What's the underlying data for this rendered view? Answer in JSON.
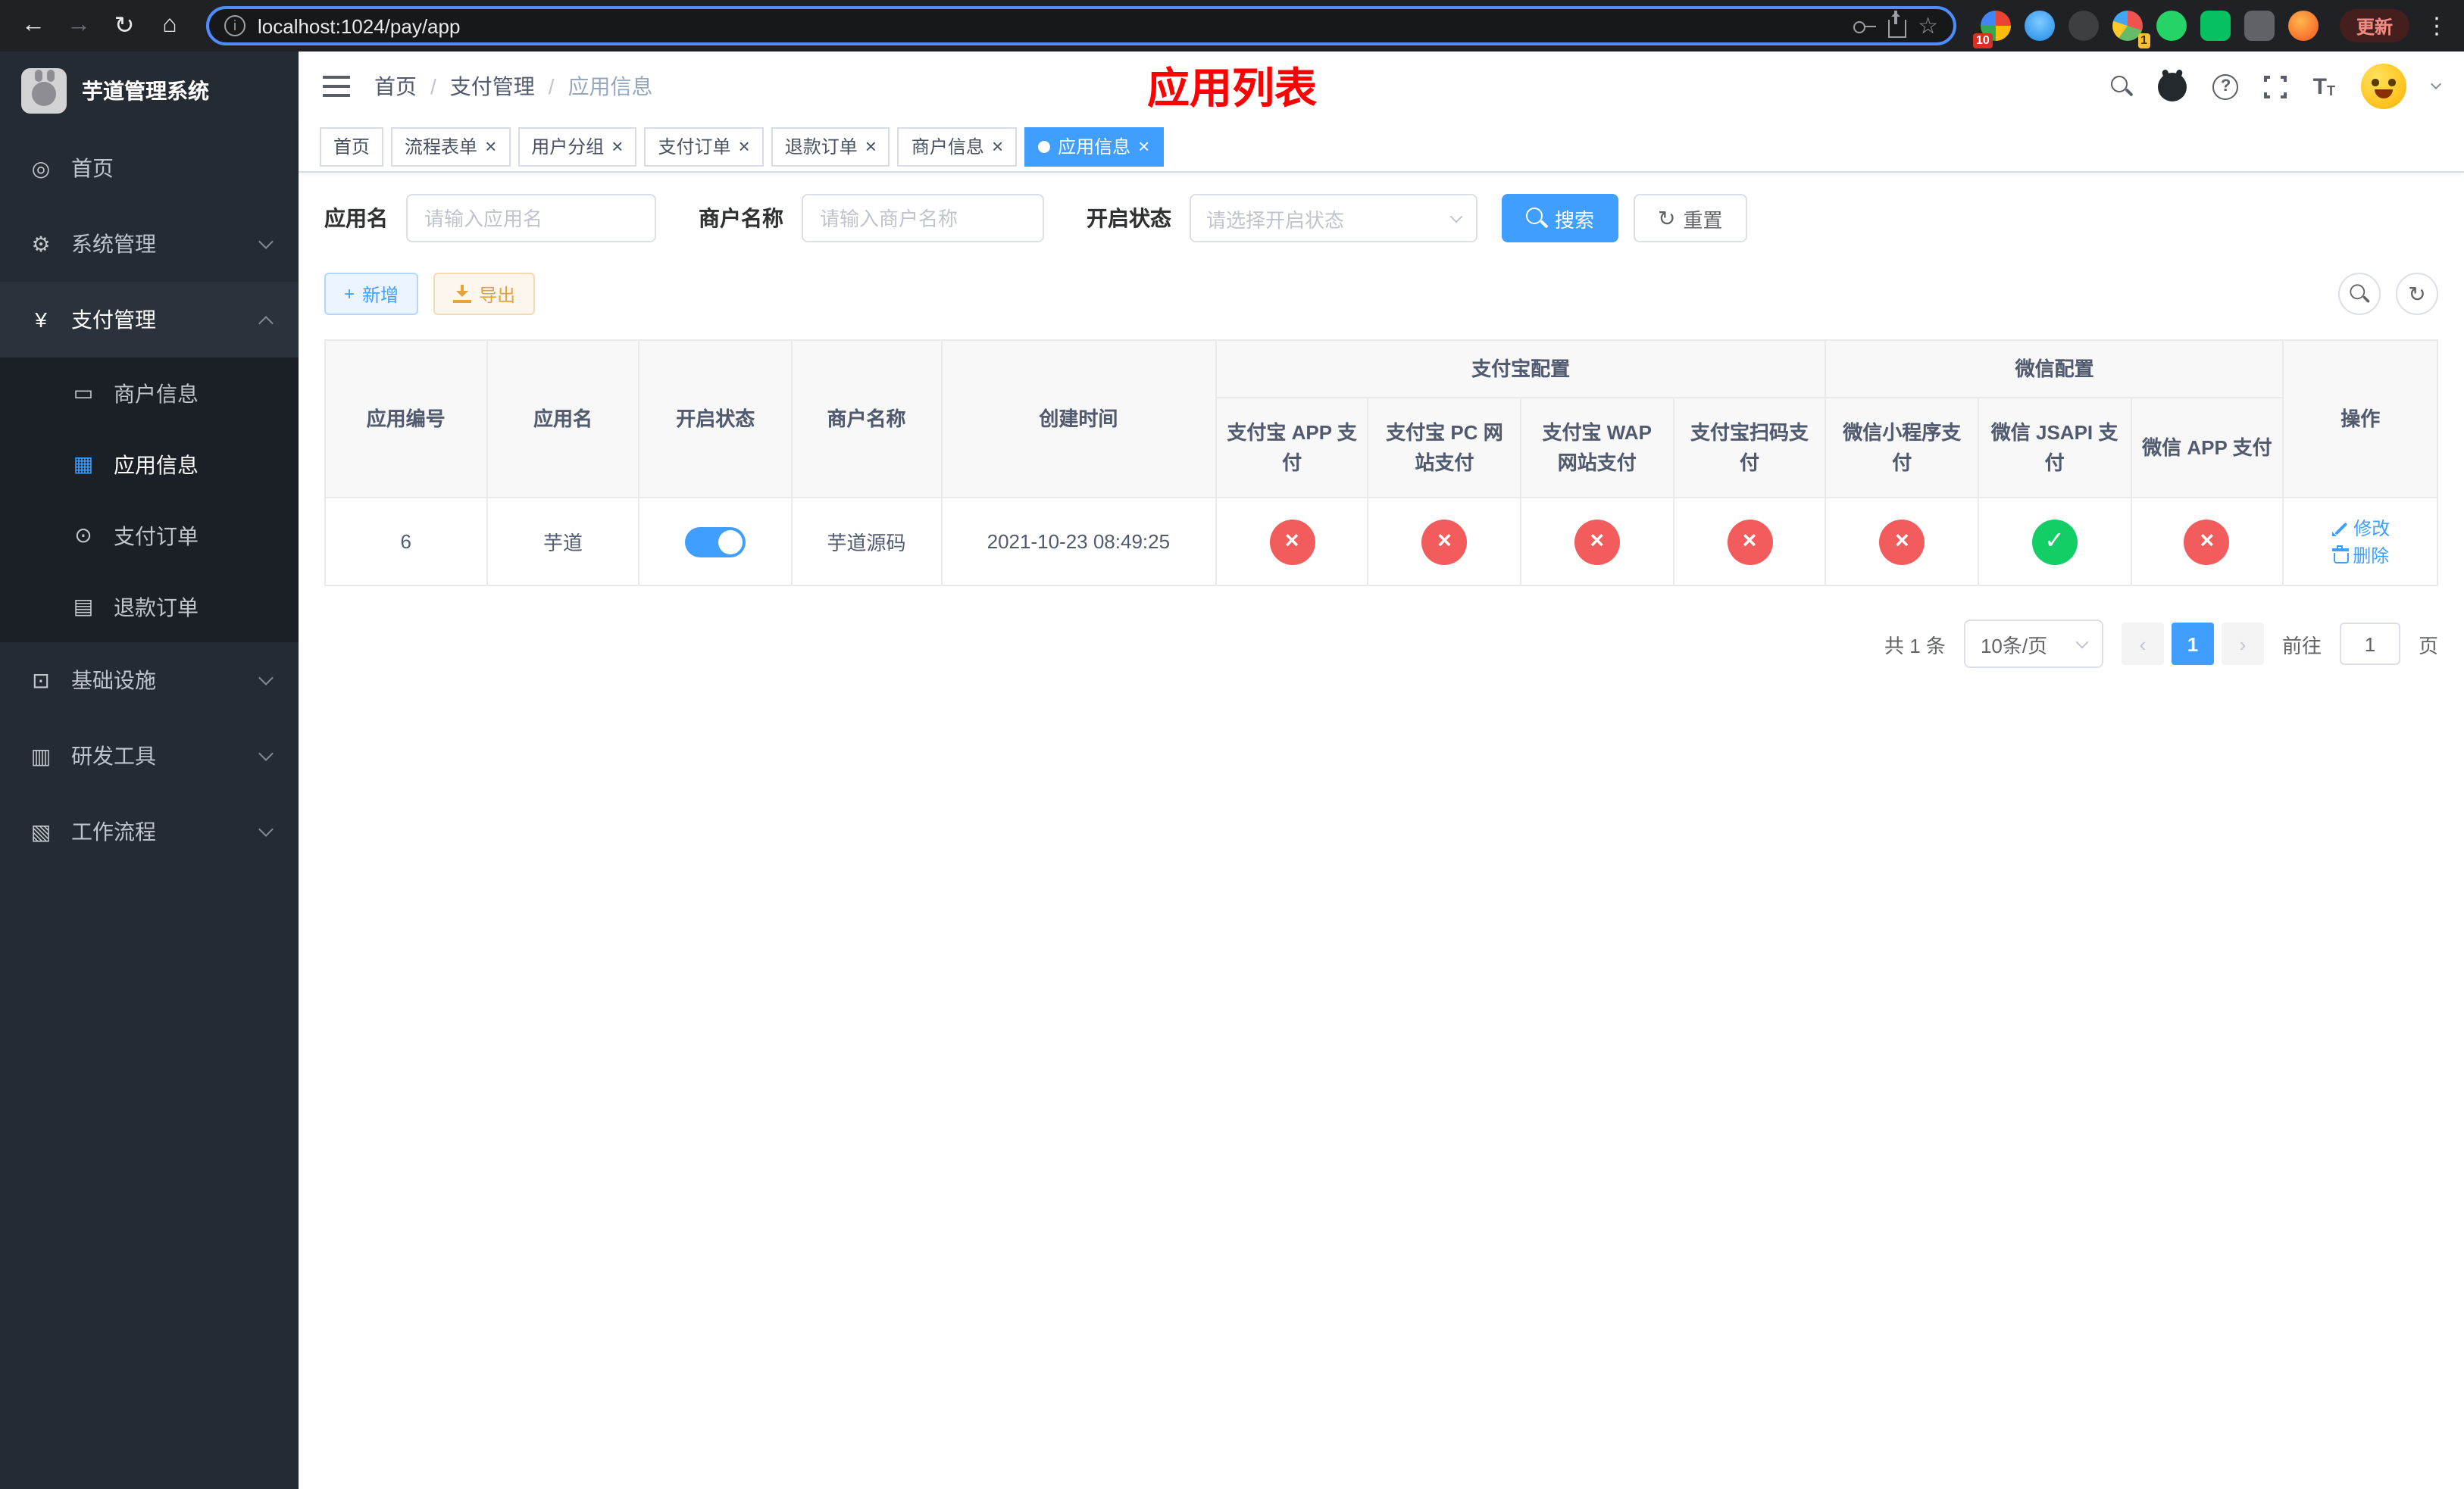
{
  "colors": {
    "primary": "#409eff",
    "success": "#13ce66",
    "danger": "#f25c5c",
    "warning": "#e6a23c",
    "title_red": "#ff0000"
  },
  "icons": {
    "back": "←",
    "forward": "→",
    "reload": "↻",
    "home": "⌂",
    "info": "i",
    "star": "☆",
    "dots": "⋮",
    "question": "?",
    "font": "T",
    "plus": "+",
    "prev": "‹",
    "next": "›",
    "close": "×",
    "check": "✓",
    "dashboard": "◎",
    "gear": "⚙",
    "yen": "¥",
    "card": "▭",
    "grid": "▦",
    "order": "⊙",
    "refund": "▤",
    "infra": "⊡",
    "tool": "▥",
    "flow": "▧"
  },
  "browser": {
    "url": "localhost:1024/pay/app",
    "update_label": "更新",
    "ext_badge_1": "10",
    "ext_badge_2": "1"
  },
  "sidebar": {
    "logo_title": "芋道管理系统",
    "menu": [
      {
        "label": "首页"
      },
      {
        "label": "系统管理"
      },
      {
        "label": "支付管理"
      },
      {
        "label": "商户信息"
      },
      {
        "label": "应用信息"
      },
      {
        "label": "支付订单"
      },
      {
        "label": "退款订单"
      },
      {
        "label": "基础设施"
      },
      {
        "label": "研发工具"
      },
      {
        "label": "工作流程"
      }
    ]
  },
  "header": {
    "breadcrumb": [
      "首页",
      "支付管理",
      "应用信息"
    ],
    "breadcrumb_sep": "/",
    "page_title": "应用列表"
  },
  "tabs": [
    {
      "label": "首页",
      "closable": false,
      "active": false
    },
    {
      "label": "流程表单",
      "closable": true,
      "active": false
    },
    {
      "label": "用户分组",
      "closable": true,
      "active": false
    },
    {
      "label": "支付订单",
      "closable": true,
      "active": false
    },
    {
      "label": "退款订单",
      "closable": true,
      "active": false
    },
    {
      "label": "商户信息",
      "closable": true,
      "active": false
    },
    {
      "label": "应用信息",
      "closable": true,
      "active": true
    }
  ],
  "filters": {
    "app_name_label": "应用名",
    "app_name_placeholder": "请输入应用名",
    "merchant_label": "商户名称",
    "merchant_placeholder": "请输入商户名称",
    "status_label": "开启状态",
    "status_placeholder": "请选择开启状态",
    "search_label": "搜索",
    "reset_label": "重置"
  },
  "toolbar": {
    "add_label": "新增",
    "export_label": "导出"
  },
  "table": {
    "groups": {
      "alipay": "支付宝配置",
      "wechat": "微信配置"
    },
    "columns": [
      "应用编号",
      "应用名",
      "开启状态",
      "商户名称",
      "创建时间",
      "支付宝 APP 支付",
      "支付宝 PC 网站支付",
      "支付宝 WAP 网站支付",
      "支付宝扫码支付",
      "微信小程序支付",
      "微信 JSAPI 支付",
      "微信 APP 支付",
      "操作"
    ],
    "rows": [
      {
        "id": "6",
        "name": "芋道",
        "enabled": true,
        "merchant": "芋道源码",
        "created": "2021-10-23 08:49:25",
        "channels": [
          false,
          false,
          false,
          false,
          false,
          true,
          false
        ]
      }
    ],
    "actions": {
      "edit": "修改",
      "delete": "删除"
    }
  },
  "pagination": {
    "total": "共 1 条",
    "page_size": "10条/页",
    "current_page": "1",
    "goto_label": "前往",
    "goto_value": "1",
    "page_suffix": "页"
  }
}
